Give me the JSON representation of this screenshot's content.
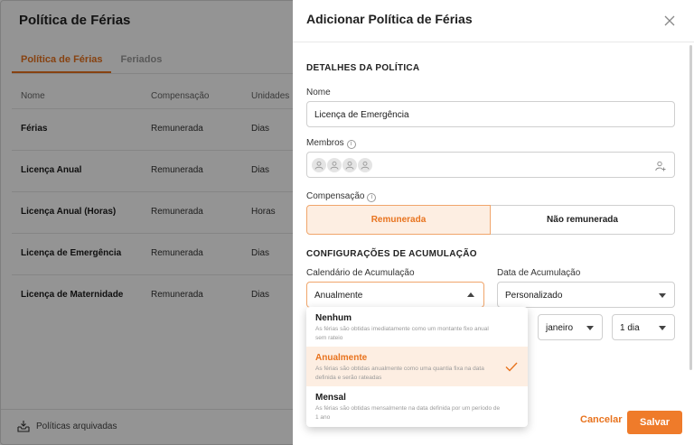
{
  "background": {
    "title": "Política de Férias",
    "tabs": [
      "Política de Férias",
      "Feriados"
    ],
    "columns": [
      "Nome",
      "Compensação",
      "Unidades"
    ],
    "rows": [
      {
        "name": "Férias",
        "compensation": "Remunerada",
        "unit": "Dias"
      },
      {
        "name": "Licença Anual",
        "compensation": "Remunerada",
        "unit": "Dias"
      },
      {
        "name": "Licença Anual (Horas)",
        "compensation": "Remunerada",
        "unit": "Horas"
      },
      {
        "name": "Licença de Emergência",
        "compensation": "Remunerada",
        "unit": "Dias"
      },
      {
        "name": "Licença de Maternidade",
        "compensation": "Remunerada",
        "unit": "Dias"
      }
    ],
    "archived_label": "Políticas arquivadas"
  },
  "drawer": {
    "title": "Adicionar Política de Férias",
    "section_details": "DETALHES DA POLÍTICA",
    "name_label": "Nome",
    "name_value": "Licença de Emergência",
    "members_label": "Membros",
    "compensation_label": "Compensação",
    "compensation_options": [
      "Remunerada",
      "Não remunerada"
    ],
    "compensation_selected": "Remunerada",
    "section_accrual": "CONFIGURAÇÕES DE ACUMULAÇÃO",
    "accrual_calendar_label": "Calendário de Acumulação",
    "accrual_calendar_value": "Anualmente",
    "accrual_date_label": "Data de Acumulação",
    "accrual_date_value": "Personalizado",
    "month_value": "janeiro",
    "day_value": "1 dia",
    "cancel_label": "Cancelar",
    "save_label": "Salvar"
  },
  "dropdown": {
    "options": [
      {
        "title": "Nenhum",
        "desc": "As férias são obtidas imediatamente como um montante fixo anual sem rateio"
      },
      {
        "title": "Anualmente",
        "desc": "As férias são obtidas anualmente como uma quantia fixa na data definida e serão rateadas"
      },
      {
        "title": "Mensal",
        "desc": "As férias são obtidas mensalmente na data definida por um período de 1 ano"
      }
    ],
    "selected": "Anualmente"
  },
  "colors": {
    "accent": "#e8731e",
    "accent_bg": "#fdeee2",
    "save_button": "#ef7b2a"
  },
  "icons": [
    "close-icon",
    "info-icon",
    "user-avatar-icon",
    "add-user-icon",
    "chevron-down-icon",
    "chevron-up-icon",
    "check-icon",
    "archive-inbox-icon"
  ]
}
